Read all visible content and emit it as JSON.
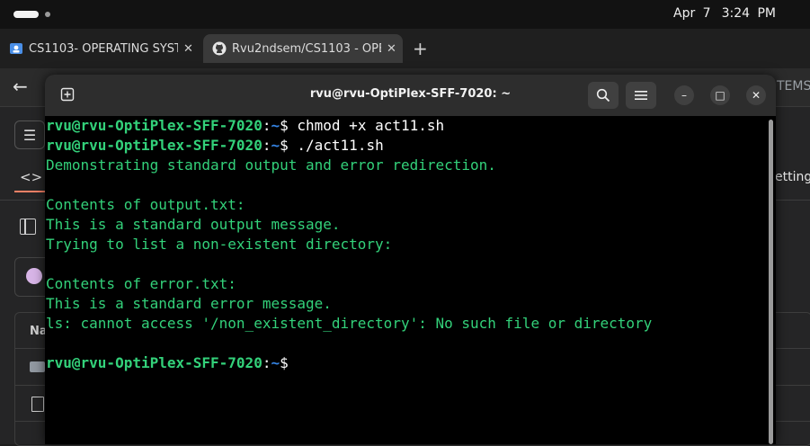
{
  "system": {
    "date": "Apr 7",
    "time": "3:24 PM"
  },
  "browser": {
    "tabs": [
      {
        "title": "CS1103- OPERATING SYST",
        "favicon": "classroom-icon",
        "active": false
      },
      {
        "title": "Rvu2ndsem/CS1103 - OPE",
        "favicon": "github-icon",
        "active": true
      }
    ],
    "new_tab_label": "+",
    "address_tail": "TEMS/",
    "settings_tab_tail": "etting",
    "file_list_header": "Na"
  },
  "terminal": {
    "title": "rvu@rvu-OptiPlex-SFF-7020: ~",
    "buttons": {
      "minimize": "–",
      "maximize": "□",
      "close": "✕"
    },
    "lines": [
      {
        "kind": "prompt",
        "user": "rvu@rvu-OptiPlex-SFF-7020",
        "sep": ":",
        "path": "~",
        "sym": "$",
        "cmd": " chmod +x act11.sh"
      },
      {
        "kind": "prompt",
        "user": "rvu@rvu-OptiPlex-SFF-7020",
        "sep": ":",
        "path": "~",
        "sym": "$",
        "cmd": " ./act11.sh"
      },
      {
        "kind": "out",
        "text": "Demonstrating standard output and error redirection."
      },
      {
        "kind": "out",
        "text": ""
      },
      {
        "kind": "out",
        "text": "Contents of output.txt:"
      },
      {
        "kind": "out",
        "text": "This is a standard output message."
      },
      {
        "kind": "out",
        "text": "Trying to list a non-existent directory:"
      },
      {
        "kind": "out",
        "text": ""
      },
      {
        "kind": "out",
        "text": "Contents of error.txt:"
      },
      {
        "kind": "out",
        "text": "This is a standard error message."
      },
      {
        "kind": "out",
        "text": "ls: cannot access '/non_existent_directory': No such file or directory"
      },
      {
        "kind": "out",
        "text": ""
      },
      {
        "kind": "prompt",
        "user": "rvu@rvu-OptiPlex-SFF-7020",
        "sep": ":",
        "path": "~",
        "sym": "$",
        "cmd": ""
      }
    ],
    "colors": {
      "output": "#33d17a",
      "prompt_user": "#33d17a",
      "prompt_path": "#3584e4",
      "background": "#000000"
    }
  }
}
